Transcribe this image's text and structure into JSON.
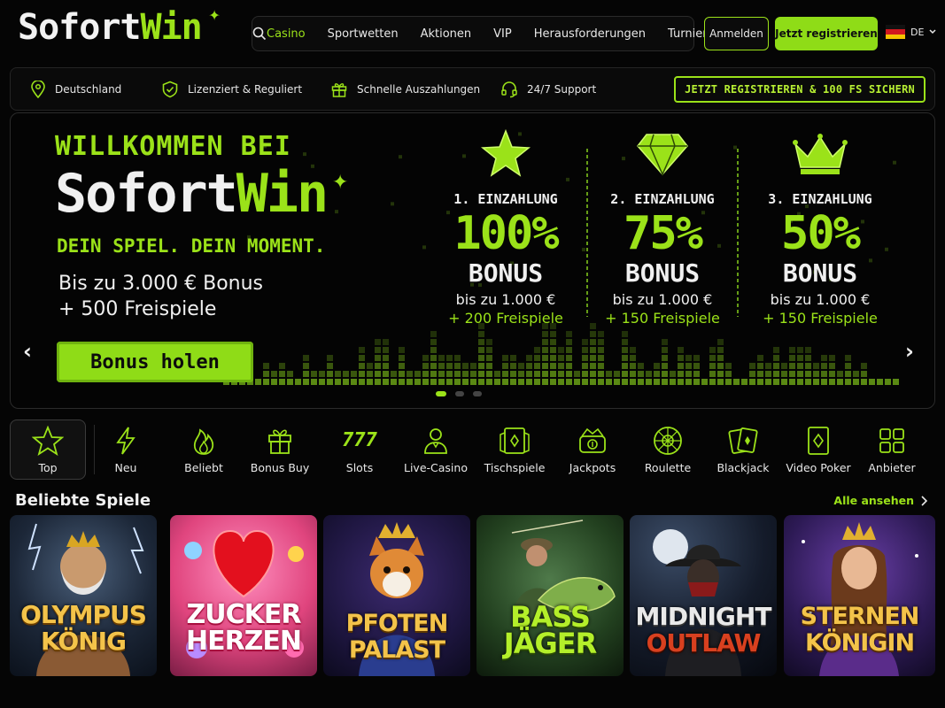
{
  "brand": {
    "logo_part1": "Sofort",
    "logo_part2": "Win"
  },
  "nav": {
    "items": [
      "Casino",
      "Sportwetten",
      "Aktionen",
      "VIP",
      "Herausforderungen",
      "Turniere"
    ],
    "active": "Casino"
  },
  "auth": {
    "login_label": "Anmelden",
    "register_label": "Jetzt registrieren"
  },
  "language": {
    "code": "DE"
  },
  "infobar": {
    "items": [
      "Deutschland",
      "Lizenziert & Reguliert",
      "Schnelle Auszahlungen",
      "24/7 Support"
    ],
    "cta": "JETZT REGISTRIEREN & 100 FS SICHERN"
  },
  "hero": {
    "welcome": "WILLKOMMEN BEI",
    "logo_part1": "Sofort",
    "logo_part2": "Win",
    "tagline": "DEIN SPIEL. DEIN MOMENT.",
    "bonus_line1": "Bis zu 3.000 € Bonus",
    "bonus_line2": "+ 500 Freispiele",
    "cta": "Bonus holen",
    "offers": [
      {
        "icon": "star-icon",
        "deposit": "1. EINZAHLUNG",
        "percent": "100%",
        "bonus": "BONUS",
        "upto": "bis zu 1.000 €",
        "spins": "+ 200 Freispiele"
      },
      {
        "icon": "diamond-icon",
        "deposit": "2. EINZAHLUNG",
        "percent": "75%",
        "bonus": "BONUS",
        "upto": "bis zu 1.000 €",
        "spins": "+ 150 Freispiele"
      },
      {
        "icon": "crown-icon",
        "deposit": "3. EINZAHLUNG",
        "percent": "50%",
        "bonus": "BONUS",
        "upto": "bis zu 1.000 €",
        "spins": "+ 150 Freispiele"
      }
    ],
    "slides": {
      "count": 3,
      "active": 1
    }
  },
  "categories": [
    {
      "label": "Top",
      "icon": "star-outline-icon",
      "active": true
    },
    {
      "label": "Neu",
      "icon": "lightning-icon"
    },
    {
      "label": "Beliebt",
      "icon": "flame-icon"
    },
    {
      "label": "Bonus Buy",
      "icon": "gift-icon"
    },
    {
      "label": "Slots",
      "icon": "777-icon"
    },
    {
      "label": "Live-Casino",
      "icon": "dealer-icon"
    },
    {
      "label": "Tischspiele",
      "icon": "cards-table-icon"
    },
    {
      "label": "Jackpots",
      "icon": "jackpot-icon"
    },
    {
      "label": "Roulette",
      "icon": "roulette-icon"
    },
    {
      "label": "Blackjack",
      "icon": "blackjack-icon"
    },
    {
      "label": "Video Poker",
      "icon": "video-poker-icon"
    },
    {
      "label": "Anbieter",
      "icon": "grid-icon"
    }
  ],
  "games": {
    "section_title": "Beliebte Spiele",
    "see_all": "Alle ansehen",
    "items": [
      {
        "line1": "OLYMPUS",
        "line2": "KÖNIG"
      },
      {
        "line1": "ZUCKER",
        "line2": "HERZEN"
      },
      {
        "line1": "PFOTEN",
        "line2": "PALAST"
      },
      {
        "line1": "BASS",
        "line2": "JÄGER"
      },
      {
        "line1": "MIDNIGHT",
        "line2": "OUTLAW"
      },
      {
        "line1": "STERNEN",
        "line2": "KÖNIGIN"
      }
    ]
  },
  "colors": {
    "accent": "#9be219",
    "background": "#050505"
  }
}
